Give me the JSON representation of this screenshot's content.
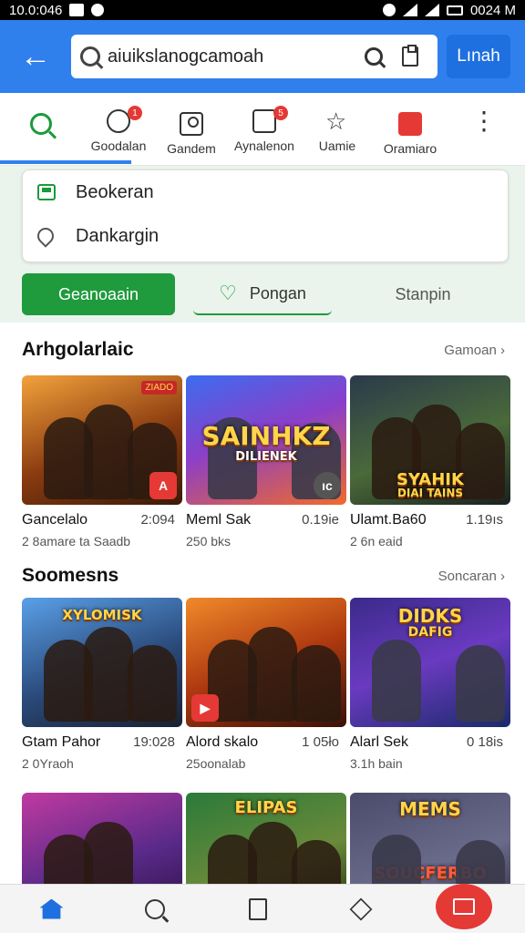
{
  "status_bar": {
    "left_text": "10.0:046",
    "right_text": "0024 M"
  },
  "search_bar": {
    "query": "aiuikslanogcamoah",
    "submit_label": "Lınah"
  },
  "category_tabs": [
    {
      "label": "",
      "icon": "search-icon"
    },
    {
      "label": "Goodalan",
      "icon": "chat-icon",
      "badge": "1"
    },
    {
      "label": "Gandem",
      "icon": "camera-icon"
    },
    {
      "label": "Aynalenon",
      "icon": "chart-icon",
      "badge": "5"
    },
    {
      "label": "Uamie",
      "icon": "star-icon"
    },
    {
      "label": "Oramiaro",
      "icon": "square-icon"
    },
    {
      "label": "",
      "icon": "kebab-icon"
    }
  ],
  "suggestions": [
    {
      "label": "Beokeran",
      "icon": "bookmark-icon"
    },
    {
      "label": "Dankargin",
      "icon": "location-pin-icon"
    }
  ],
  "filter_chips": {
    "primary": "Geanoaain",
    "secondary": "Pongan",
    "tertiary": "Stanpin"
  },
  "sections": [
    {
      "title": "Arhgolarlaic",
      "more_label": "Gamoan ›",
      "games": [
        {
          "name": "Gancelalo",
          "score": "2:094",
          "sub": "2 8amare ta Saadb",
          "art": "",
          "tag": "ZIADO",
          "badge": "A"
        },
        {
          "name": "Meml Sak",
          "score": "0.19ie",
          "sub": "250 bks",
          "art": "SAINHKZ",
          "art2": "DILIENEK",
          "tag": "",
          "badge": "ıc"
        },
        {
          "name": "Ulamt.Ba60",
          "score": "1.19ıs",
          "sub": "2 6n eaid",
          "art": "SYAHIK",
          "art2": "DIAI TAINS",
          "tag": "",
          "badge": ""
        }
      ]
    },
    {
      "title": "Soomesns",
      "more_label": "Soncaran ›",
      "games": [
        {
          "name": "Gtam Pahor",
          "score": "19:028",
          "sub": "2 0Yraoh",
          "art": "XYLOMISK",
          "art2": "",
          "tag": "",
          "badge": ""
        },
        {
          "name": "Alord skalo",
          "score": "1 05ło",
          "sub": "25oonalab",
          "art": "",
          "art2": "",
          "tag": "",
          "badge": ""
        },
        {
          "name": "Alarl Sek",
          "score": "0 18is",
          "sub": "3.1h bain",
          "art": "DIDKS",
          "art2": "DAFIG",
          "tag": "",
          "badge": ""
        }
      ]
    },
    {
      "title": "",
      "more_label": "",
      "games": [
        {
          "name": "",
          "score": "",
          "sub": "",
          "art": "",
          "art2": ""
        },
        {
          "name": "",
          "score": "",
          "sub": "",
          "art": "ELIPAS",
          "art2": ""
        },
        {
          "name": "",
          "score": "",
          "sub": "",
          "art": "MEMS",
          "art2": "SOUCFERBO"
        }
      ]
    }
  ],
  "bottom_nav": [
    {
      "icon": "home-icon",
      "active": true
    },
    {
      "icon": "search-icon"
    },
    {
      "icon": "book-icon"
    },
    {
      "icon": "cube-icon"
    },
    {
      "icon": "mail-icon"
    }
  ],
  "colors": {
    "primary_blue": "#2f80ed",
    "accent_green": "#1f9a3c",
    "badge_red": "#e53935"
  }
}
